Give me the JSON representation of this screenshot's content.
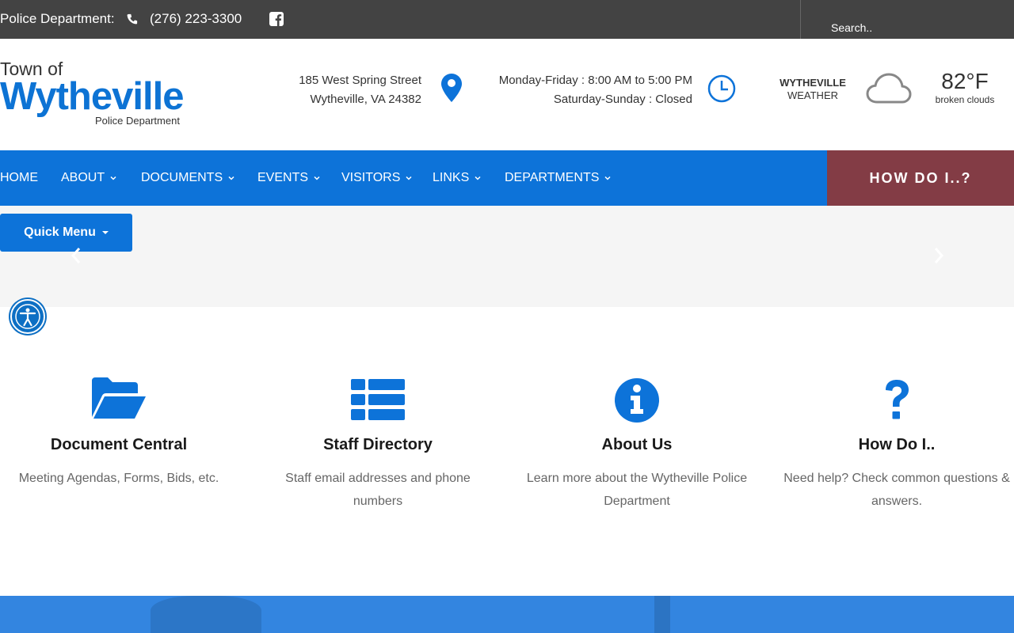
{
  "topbar": {
    "dept_label": "Police Department:",
    "phone": "(276) 223-3300",
    "search_placeholder": "Search.."
  },
  "logo": {
    "town_of": "Town of",
    "name": "Wytheville",
    "subtitle": "Police Department"
  },
  "address": {
    "line1": "185 West Spring Street",
    "line2": "Wytheville, VA 24382"
  },
  "hours": {
    "weekday": "Monday-Friday : 8:00 AM to 5:00 PM",
    "weekend": "Saturday-Sunday : Closed"
  },
  "weather": {
    "city": "WYTHEVILLE",
    "label": "WEATHER",
    "temp": "82°F",
    "condition": "broken clouds"
  },
  "nav": {
    "items": [
      {
        "label": "HOME"
      },
      {
        "label": "ABOUT"
      },
      {
        "label": "DOCUMENTS"
      },
      {
        "label": "EVENTS"
      },
      {
        "label": "VISITORS"
      },
      {
        "label": "LINKS"
      },
      {
        "label": "DEPARTMENTS"
      }
    ],
    "howdo": "HOW DO I..?"
  },
  "quick_menu": "Quick Menu",
  "cards": [
    {
      "title": "Document Central",
      "desc": "Meeting Agendas, Forms, Bids, etc."
    },
    {
      "title": "Staff Directory",
      "desc": "Staff email addresses and phone numbers"
    },
    {
      "title": "About Us",
      "desc": "Learn more about the Wytheville Police Department"
    },
    {
      "title": "How Do I..",
      "desc": "Need help? Check common questions & answers."
    }
  ],
  "colors": {
    "primary": "#0d73d9",
    "accent": "#833c45",
    "topbar": "#434343"
  }
}
